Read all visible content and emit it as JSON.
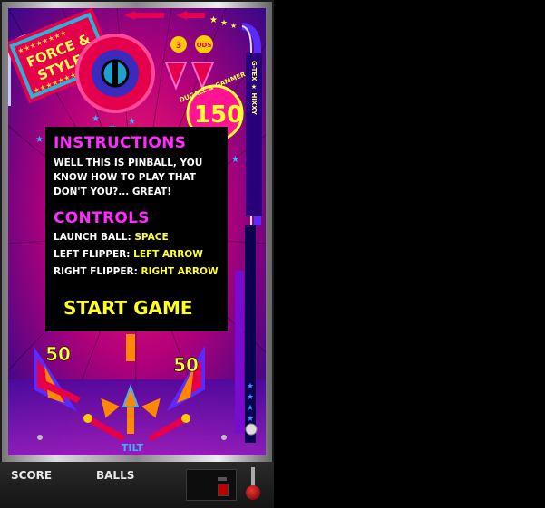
{
  "table": {
    "logo_line1": "FORCE &",
    "logo_line2": "STYLES",
    "lane_values": [
      "3",
      "ODS"
    ],
    "bumper_value": "150",
    "arc_text": "DUGALL & GAMMER",
    "side_text": "G-TEX ★ HIXXY",
    "left_score": "50",
    "right_score": "50",
    "tilt_label": "TILT",
    "colors": {
      "magenta": "#ff00ff",
      "yellow": "#ffff22",
      "red": "#e6004c",
      "blue": "#1a0a8c"
    }
  },
  "instructions": {
    "title": "INSTRUCTIONS",
    "text": "WELL THIS IS PINBALL, YOU KNOW HOW TO PLAY THAT DON'T YOU?... GREAT!"
  },
  "controls": {
    "title": "CONTROLS",
    "items": [
      {
        "label": "LAUNCH BALL: ",
        "key": "SPACE"
      },
      {
        "label": "LEFT FLIPPER: ",
        "key": "LEFT ARROW"
      },
      {
        "label": "RIGHT FLIPPER: ",
        "key": "RIGHT ARROW"
      }
    ]
  },
  "start_button": "START GAME",
  "panel": {
    "score_label": "SCORE",
    "balls_label": "BALLS"
  }
}
